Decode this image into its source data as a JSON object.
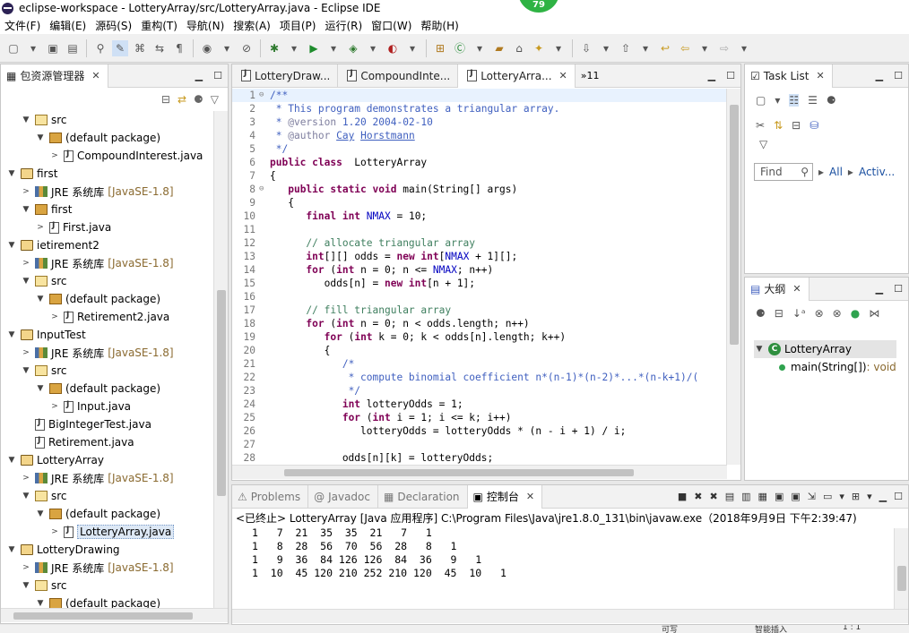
{
  "window": {
    "title": "eclipse-workspace - LotteryArray/src/LotteryArray.java - Eclipse IDE",
    "badge": "79"
  },
  "menu": [
    "文件(F)",
    "编辑(E)",
    "源码(S)",
    "重构(T)",
    "导航(N)",
    "搜索(A)",
    "项目(P)",
    "运行(R)",
    "窗口(W)",
    "帮助(H)"
  ],
  "package_explorer": {
    "title": "包资源管理器",
    "tree": [
      {
        "indent": 1,
        "arrow": "▼",
        "icon": "source-folder-icon",
        "label": "src"
      },
      {
        "indent": 2,
        "arrow": "▼",
        "icon": "package-icon",
        "label": "(default package)"
      },
      {
        "indent": 3,
        "arrow": ">",
        "icon": "java-file-icon",
        "label": "CompoundInterest.java"
      },
      {
        "indent": 0,
        "arrow": "▼",
        "icon": "project-icon",
        "label": "first"
      },
      {
        "indent": 1,
        "arrow": ">",
        "icon": "library-icon",
        "label": "JRE 系统库",
        "extra": "[JavaSE-1.8]"
      },
      {
        "indent": 1,
        "arrow": "▼",
        "icon": "package-icon",
        "label": "first"
      },
      {
        "indent": 2,
        "arrow": ">",
        "icon": "java-file-icon",
        "label": "First.java"
      },
      {
        "indent": 0,
        "arrow": "▼",
        "icon": "project-icon",
        "label": "ietirement2"
      },
      {
        "indent": 1,
        "arrow": ">",
        "icon": "library-icon",
        "label": "JRE 系统库",
        "extra": "[JavaSE-1.8]"
      },
      {
        "indent": 1,
        "arrow": "▼",
        "icon": "source-folder-icon",
        "label": "src"
      },
      {
        "indent": 2,
        "arrow": "▼",
        "icon": "package-icon",
        "label": "(default package)"
      },
      {
        "indent": 3,
        "arrow": ">",
        "icon": "java-file-icon",
        "label": "Retirement2.java"
      },
      {
        "indent": 0,
        "arrow": "▼",
        "icon": "project-icon",
        "label": "InputTest"
      },
      {
        "indent": 1,
        "arrow": ">",
        "icon": "library-icon",
        "label": "JRE 系统库",
        "extra": "[JavaSE-1.8]"
      },
      {
        "indent": 1,
        "arrow": "▼",
        "icon": "source-folder-icon",
        "label": "src"
      },
      {
        "indent": 2,
        "arrow": "▼",
        "icon": "package-icon",
        "label": "(default package)"
      },
      {
        "indent": 3,
        "arrow": ">",
        "icon": "java-file-icon",
        "label": "Input.java"
      },
      {
        "indent": 1,
        "arrow": "",
        "icon": "java-file-icon",
        "label": "BigIntegerTest.java"
      },
      {
        "indent": 1,
        "arrow": "",
        "icon": "java-file-icon",
        "label": "Retirement.java"
      },
      {
        "indent": 0,
        "arrow": "▼",
        "icon": "project-icon",
        "label": "LotteryArray"
      },
      {
        "indent": 1,
        "arrow": ">",
        "icon": "library-icon",
        "label": "JRE 系统库",
        "extra": "[JavaSE-1.8]"
      },
      {
        "indent": 1,
        "arrow": "▼",
        "icon": "source-folder-icon",
        "label": "src"
      },
      {
        "indent": 2,
        "arrow": "▼",
        "icon": "package-icon",
        "label": "(default package)"
      },
      {
        "indent": 3,
        "arrow": ">",
        "icon": "java-file-icon",
        "label": "LotteryArray.java",
        "selected": true
      },
      {
        "indent": 0,
        "arrow": "▼",
        "icon": "project-icon",
        "label": "LotteryDrawing"
      },
      {
        "indent": 1,
        "arrow": ">",
        "icon": "library-icon",
        "label": "JRE 系统库",
        "extra": "[JavaSE-1.8]"
      },
      {
        "indent": 1,
        "arrow": "▼",
        "icon": "source-folder-icon",
        "label": "src"
      },
      {
        "indent": 2,
        "arrow": "▼",
        "icon": "package-icon",
        "label": "(default package)"
      }
    ]
  },
  "editor": {
    "tabs": [
      {
        "label": "LotteryDraw...",
        "active": false
      },
      {
        "label": "CompoundInte...",
        "active": false
      },
      {
        "label": "LotteryArra...",
        "active": true
      }
    ],
    "overflow": "»11",
    "lines": [
      [
        [
          "jd",
          "/**"
        ]
      ],
      [
        [
          "jd",
          " * This program demonstrates a triangular array."
        ]
      ],
      [
        [
          "jd",
          " * "
        ],
        [
          "ann",
          "@version"
        ],
        [
          "jd",
          " 1.20 2004-02-10"
        ]
      ],
      [
        [
          "jd",
          " * "
        ],
        [
          "ann",
          "@author"
        ],
        [
          "jd",
          " "
        ],
        [
          "jdu",
          "Cay"
        ],
        [
          "jd",
          " "
        ],
        [
          "jdu",
          "Horstmann"
        ]
      ],
      [
        [
          "jd",
          " */"
        ]
      ],
      [
        [
          "kw",
          "public class"
        ],
        [
          "",
          "  LotteryArray"
        ]
      ],
      [
        [
          "",
          "{"
        ]
      ],
      [
        [
          "",
          "   "
        ],
        [
          "kw",
          "public static void"
        ],
        [
          "",
          " main(String[] args)"
        ]
      ],
      [
        [
          "",
          "   {"
        ]
      ],
      [
        [
          "",
          "      "
        ],
        [
          "kw",
          "final int"
        ],
        [
          "",
          " "
        ],
        [
          "fd",
          "NMAX"
        ],
        [
          "",
          " = 10;"
        ]
      ],
      [
        [
          "",
          ""
        ]
      ],
      [
        [
          "",
          "      "
        ],
        [
          "cm",
          "// allocate triangular array"
        ]
      ],
      [
        [
          "",
          "      "
        ],
        [
          "kw",
          "int"
        ],
        [
          "",
          "[][] odds = "
        ],
        [
          "kw",
          "new int"
        ],
        [
          "",
          "["
        ],
        [
          "fd",
          "NMAX"
        ],
        [
          "",
          " + 1][];"
        ]
      ],
      [
        [
          "",
          "      "
        ],
        [
          "kw",
          "for"
        ],
        [
          "",
          " ("
        ],
        [
          "kw",
          "int"
        ],
        [
          "",
          " n = 0; n <= "
        ],
        [
          "fd",
          "NMAX"
        ],
        [
          "",
          "; n++)"
        ]
      ],
      [
        [
          "",
          "         odds[n] = "
        ],
        [
          "kw",
          "new int"
        ],
        [
          "",
          "[n + 1];"
        ]
      ],
      [
        [
          "",
          ""
        ]
      ],
      [
        [
          "",
          "      "
        ],
        [
          "cm",
          "// fill triangular array"
        ]
      ],
      [
        [
          "",
          "      "
        ],
        [
          "kw",
          "for"
        ],
        [
          "",
          " ("
        ],
        [
          "kw",
          "int"
        ],
        [
          "",
          " n = 0; n < odds.length; n++)"
        ]
      ],
      [
        [
          "",
          "         "
        ],
        [
          "kw",
          "for"
        ],
        [
          "",
          " ("
        ],
        [
          "kw",
          "int"
        ],
        [
          "",
          " k = 0; k < odds[n].length; k++)"
        ]
      ],
      [
        [
          "",
          "         {"
        ]
      ],
      [
        [
          "",
          "            "
        ],
        [
          "jd",
          "/*"
        ]
      ],
      [
        [
          "",
          "            "
        ],
        [
          "jd",
          " * compute binomial coefficient n*(n-1)*(n-2)*...*(n-k+1)/("
        ]
      ],
      [
        [
          "",
          "            "
        ],
        [
          "jd",
          " */"
        ]
      ],
      [
        [
          "",
          "            "
        ],
        [
          "kw",
          "int"
        ],
        [
          "",
          " lotteryOdds = 1;"
        ]
      ],
      [
        [
          "",
          "            "
        ],
        [
          "kw",
          "for"
        ],
        [
          "",
          " ("
        ],
        [
          "kw",
          "int"
        ],
        [
          "",
          " i = 1; i <= k; i++)"
        ]
      ],
      [
        [
          "",
          "               lotteryOdds = lotteryOdds * (n - i + 1) / i;"
        ]
      ],
      [
        [
          "",
          ""
        ]
      ],
      [
        [
          "",
          "            odds[n][k] = lotteryOdds;"
        ]
      ]
    ]
  },
  "task_list": {
    "title": "Task List",
    "find_placeholder": "Find",
    "all_label": "All",
    "activ_label": "Activ..."
  },
  "outline": {
    "title": "大纲",
    "class_name": "LotteryArray",
    "method": "main(String[])",
    "method_type": " : void"
  },
  "console": {
    "tabs": [
      {
        "label": "Problems",
        "active": false
      },
      {
        "label": "Javadoc",
        "active": false
      },
      {
        "label": "Declaration",
        "active": false
      },
      {
        "label": "控制台",
        "active": true
      }
    ],
    "terminated": "<已终止> LotteryArray [Java 应用程序] C:\\Program Files\\Java\\jre1.8.0_131\\bin\\javaw.exe（2018年9月9日 下午2:39:47)",
    "output": [
      "1   7  21  35  35  21   7   1",
      "1   8  28  56  70  56  28   8   1",
      "1   9  36  84 126 126  84  36   9   1",
      "1  10  45 120 210 252 210 120  45  10   1"
    ]
  },
  "status": {
    "writable": "可写",
    "insert": "智能插入",
    "position": "1 : 1"
  }
}
